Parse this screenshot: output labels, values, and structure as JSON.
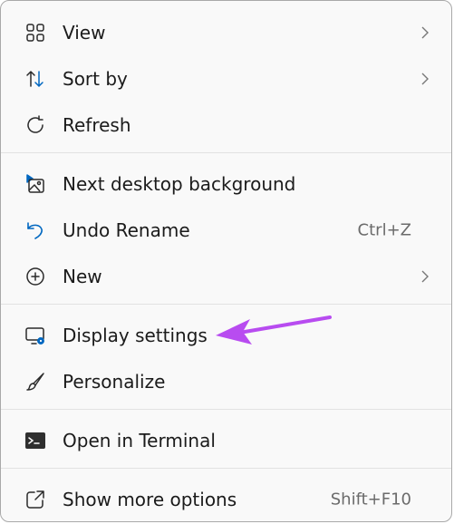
{
  "menu": {
    "items": [
      {
        "key": "view",
        "label": "View",
        "icon": "grid-icon",
        "shortcut": "",
        "submenu": true
      },
      {
        "key": "sort",
        "label": "Sort by",
        "icon": "sort-icon",
        "shortcut": "",
        "submenu": true
      },
      {
        "key": "refresh",
        "label": "Refresh",
        "icon": "refresh-icon",
        "shortcut": "",
        "submenu": false
      },
      {
        "key": "next-bg",
        "label": "Next desktop background",
        "icon": "next-background-icon",
        "shortcut": "",
        "submenu": false
      },
      {
        "key": "undo",
        "label": "Undo Rename",
        "icon": "undo-icon",
        "shortcut": "Ctrl+Z",
        "submenu": false
      },
      {
        "key": "new",
        "label": "New",
        "icon": "plus-circle-icon",
        "shortcut": "",
        "submenu": true
      },
      {
        "key": "display",
        "label": "Display settings",
        "icon": "display-settings-icon",
        "shortcut": "",
        "submenu": false
      },
      {
        "key": "personalize",
        "label": "Personalize",
        "icon": "brush-icon",
        "shortcut": "",
        "submenu": false
      },
      {
        "key": "terminal",
        "label": "Open in Terminal",
        "icon": "terminal-icon",
        "shortcut": "",
        "submenu": false
      },
      {
        "key": "more",
        "label": "Show more options",
        "icon": "show-more-icon",
        "shortcut": "Shift+F10",
        "submenu": false
      }
    ]
  },
  "colors": {
    "menu_bg": "#f9f9f9",
    "text": "#1b1b1b",
    "shortcut_text": "#6b6b6b",
    "icon_accent": "#0067c0",
    "annotation_arrow": "#b84cf0"
  }
}
